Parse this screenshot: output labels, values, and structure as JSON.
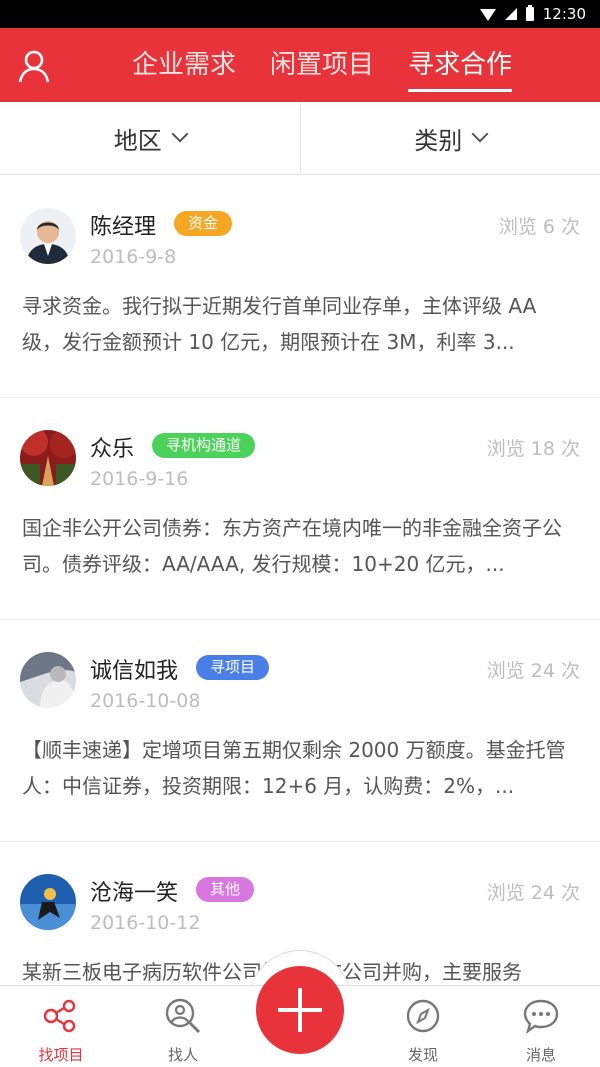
{
  "status_bar": {
    "time": "12:30"
  },
  "header": {
    "tabs": [
      {
        "label": "企业需求",
        "active": false
      },
      {
        "label": "闲置项目",
        "active": false
      },
      {
        "label": "寻求合作",
        "active": true
      }
    ]
  },
  "filters": {
    "region": "地区",
    "category": "类别"
  },
  "posts": [
    {
      "name": "陈经理",
      "tag": "资金",
      "tag_color": "#f5a623",
      "views": "浏览 6 次",
      "date": "2016-9-8",
      "desc": "寻求资金。我行拟于近期发行首单同业存单，主体评级 AA 级，发行金额预计 10 亿元，期限预计在 3M，利率 3..."
    },
    {
      "name": "众乐",
      "tag": "寻机构通道",
      "tag_color": "#4cd15a",
      "views": "浏览 18 次",
      "date": "2016-9-16",
      "desc": "国企非公开公司债券：东方资产在境内唯一的非金融全资子公司。债券评级：AA/AAA, 发行规模：10+20 亿元，..."
    },
    {
      "name": "诚信如我",
      "tag": "寻项目",
      "tag_color": "#4a7fe8",
      "views": "浏览 24 次",
      "date": "2016-10-08",
      "desc": "【顺丰速递】定增项目第五期仅剩余 2000 万额度。基金托管人：中信证券，投资期限：12+6 月，认购费：2%，..."
    },
    {
      "name": "沧海一笑",
      "tag": "其他",
      "tag_color": "#d877e0",
      "views": "浏览 24 次",
      "date": "2016-10-12",
      "desc": "某新三板电子病历软件公司拟寻上市公司并购，主要服务"
    }
  ],
  "bottom_nav": {
    "find_project": "找项目",
    "find_people": "找人",
    "discover": "发现",
    "messages": "消息"
  },
  "colors": {
    "brand_red": "#e8333a"
  }
}
